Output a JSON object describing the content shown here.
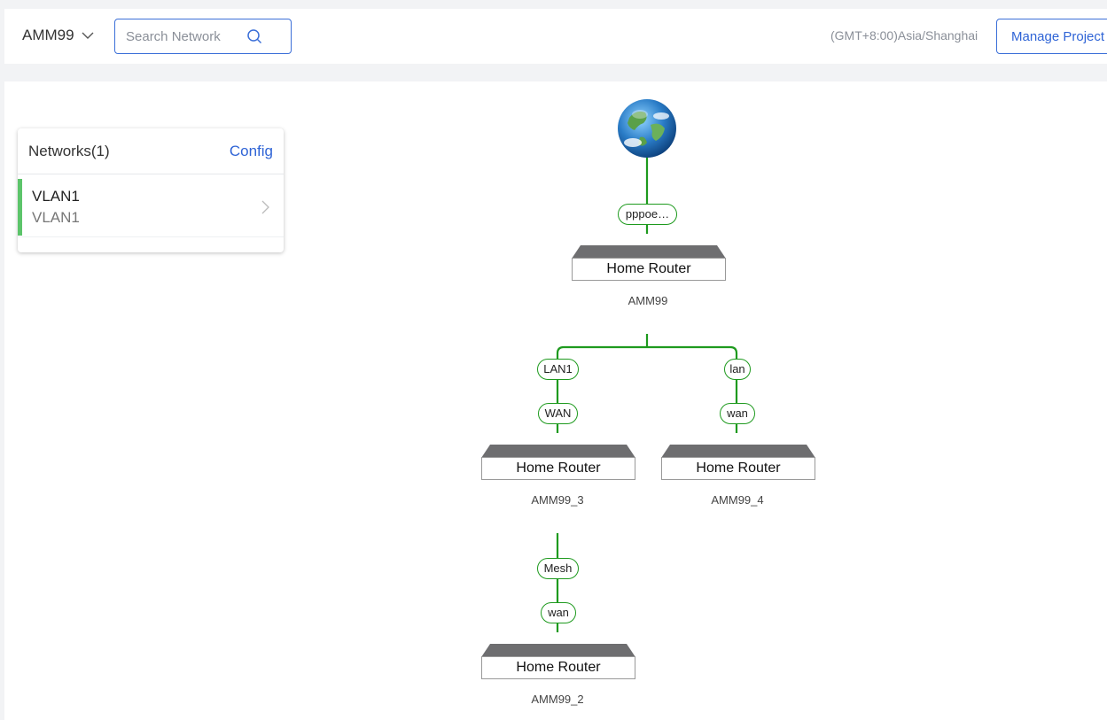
{
  "header": {
    "project_name": "AMM99",
    "search_placeholder": "Search Network",
    "timezone": "(GMT+8:00)Asia/Shanghai",
    "manage_label": "Manage Project"
  },
  "networks_panel": {
    "title": "Networks(1)",
    "config_label": "Config",
    "items": [
      {
        "name": "VLAN1",
        "sub": "VLAN1"
      }
    ]
  },
  "topology": {
    "internet_port": "pppoe…",
    "routers": [
      {
        "model": "Home Router",
        "name": "AMM99"
      },
      {
        "model": "Home Router",
        "name": "AMM99_3"
      },
      {
        "model": "Home Router",
        "name": "AMM99_4"
      },
      {
        "model": "Home Router",
        "name": "AMM99_2"
      }
    ],
    "links": [
      {
        "upstream_port": "LAN1",
        "downstream_port": "WAN"
      },
      {
        "upstream_port": "lan",
        "downstream_port": "wan"
      },
      {
        "upstream_port": "Mesh",
        "downstream_port": "wan"
      }
    ]
  },
  "colors": {
    "accent": "#2f64d6",
    "link_green": "#1e9a1e",
    "vlan_marker": "#5cc46a"
  }
}
